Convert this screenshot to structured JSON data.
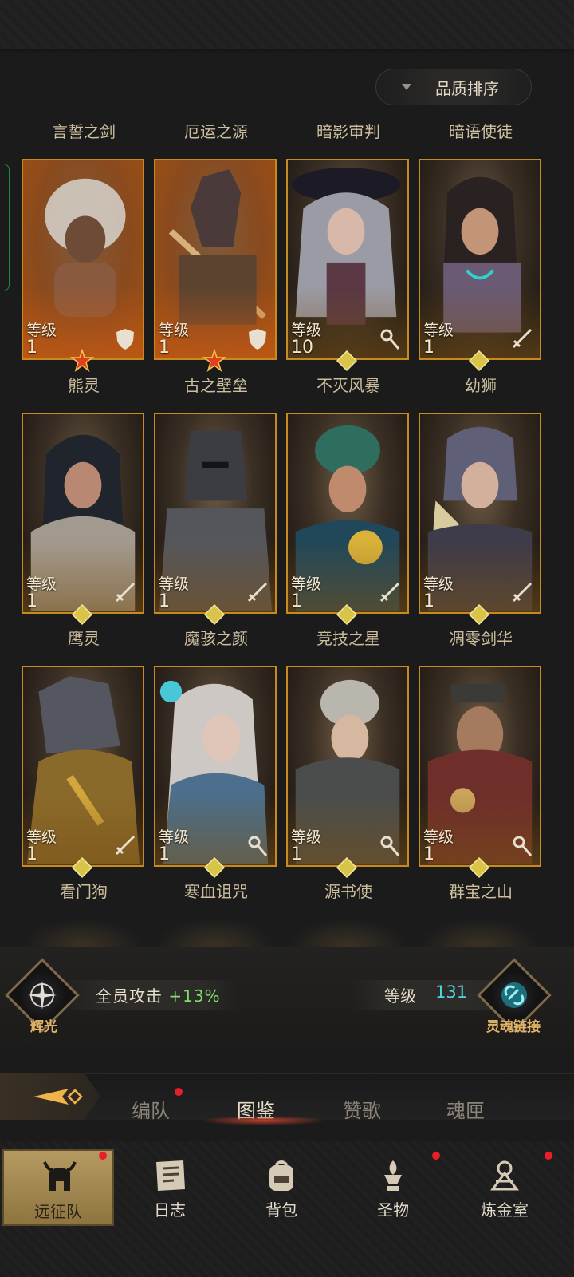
{
  "sort": {
    "label": "品质排序"
  },
  "heroes": [
    {
      "name": "言誓之剑",
      "level_label": "等级",
      "level": "1",
      "class": "shield-icon",
      "frame": "orange",
      "rank": "star"
    },
    {
      "name": "厄运之源",
      "level_label": "等级",
      "level": "1",
      "class": "shield-icon",
      "frame": "orange",
      "rank": "star"
    },
    {
      "name": "暗影审判",
      "level_label": "等级",
      "level": "10",
      "class": "staff-icon",
      "frame": "gold",
      "rank": "diamond"
    },
    {
      "name": "暗语使徒",
      "level_label": "等级",
      "level": "1",
      "class": "sword-icon",
      "frame": "gold",
      "rank": "diamond"
    },
    {
      "name": "熊灵",
      "level_label": "等级",
      "level": "1",
      "class": "sword-icon",
      "frame": "gold",
      "rank": "diamond"
    },
    {
      "name": "古之壁垒",
      "level_label": "等级",
      "level": "1",
      "class": "sword-icon",
      "frame": "gold",
      "rank": "diamond"
    },
    {
      "name": "不灭风暴",
      "level_label": "等级",
      "level": "1",
      "class": "sword-icon",
      "frame": "gold",
      "rank": "diamond"
    },
    {
      "name": "幼狮",
      "level_label": "等级",
      "level": "1",
      "class": "sword-icon",
      "frame": "gold",
      "rank": "diamond"
    },
    {
      "name": "鹰灵",
      "level_label": "等级",
      "level": "1",
      "class": "sword-icon",
      "frame": "gold",
      "rank": "diamond"
    },
    {
      "name": "魔骇之颜",
      "level_label": "等级",
      "level": "1",
      "class": "staff-icon",
      "frame": "gold",
      "rank": "diamond"
    },
    {
      "name": "竞技之星",
      "level_label": "等级",
      "level": "1",
      "class": "staff-icon",
      "frame": "gold",
      "rank": "diamond"
    },
    {
      "name": "凋零剑华",
      "level_label": "等级",
      "level": "1",
      "class": "staff-icon",
      "frame": "gold",
      "rank": "diamond"
    }
  ],
  "bottom_names": [
    "看门狗",
    "寒血诅咒",
    "源书使",
    "群宝之山"
  ],
  "buff": {
    "label": "全员攻击",
    "value": "+13%"
  },
  "radiance": {
    "caption": "辉光"
  },
  "soul_link": {
    "caption": "灵魂链接",
    "level_label": "等级",
    "level": "131"
  },
  "tabs": [
    {
      "label": "编队",
      "active": false,
      "dot": true
    },
    {
      "label": "图鉴",
      "active": true,
      "dot": false
    },
    {
      "label": "赞歌",
      "active": false,
      "dot": false
    },
    {
      "label": "魂匣",
      "active": false,
      "dot": false
    }
  ],
  "nav": [
    {
      "label": "远征队",
      "icon": "helmet-icon",
      "active": true,
      "dot": true
    },
    {
      "label": "日志",
      "icon": "journal-icon",
      "active": false,
      "dot": false
    },
    {
      "label": "背包",
      "icon": "backpack-icon",
      "active": false,
      "dot": false
    },
    {
      "label": "圣物",
      "icon": "relic-icon",
      "active": false,
      "dot": true
    },
    {
      "label": "炼金室",
      "icon": "alchemy-icon",
      "active": false,
      "dot": true
    }
  ],
  "colors": {
    "accent_gold": "#c68a1f",
    "buff_green": "#7fe06a",
    "level_cyan": "#4fd2e2",
    "notify_red": "#e81f2a"
  }
}
